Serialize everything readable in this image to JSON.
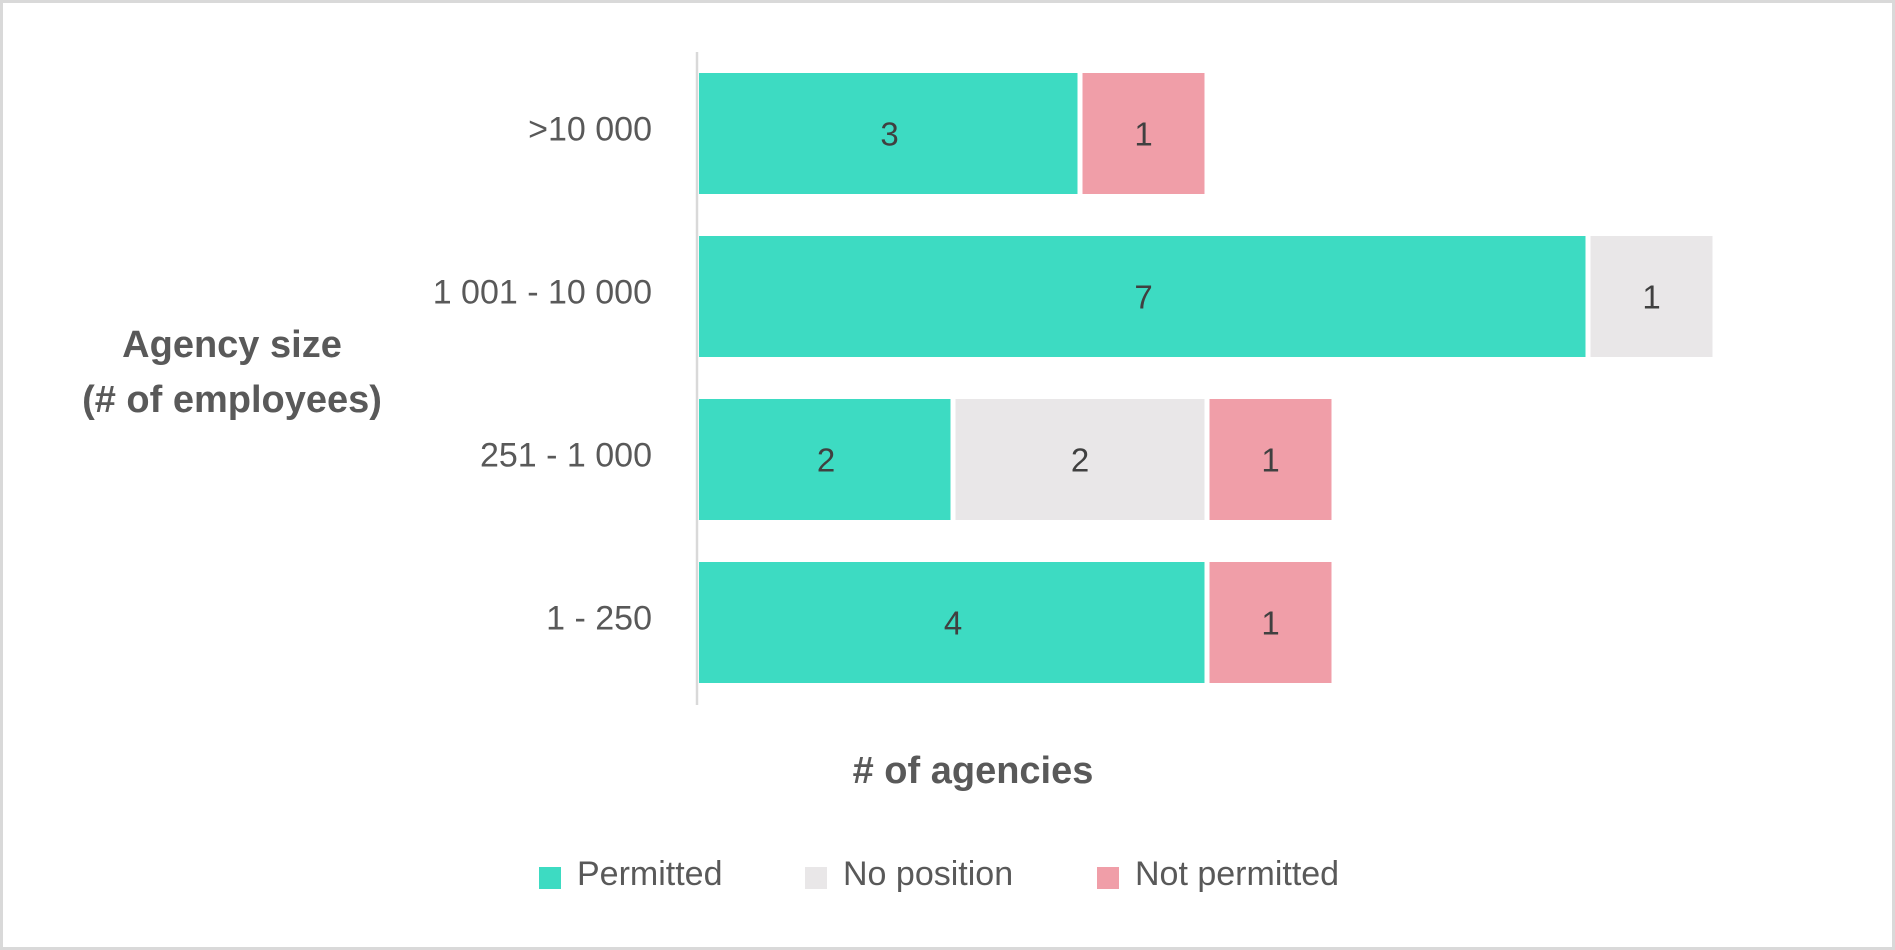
{
  "chart_data": {
    "type": "bar",
    "orientation": "horizontal",
    "stacked": true,
    "title": "",
    "xlabel": "# of agencies",
    "ylabel": [
      "Agency size",
      "(# of employees)"
    ],
    "categories": [
      ">10 000",
      "1 001 - 10 000",
      "251 - 1 000",
      "1 - 250"
    ],
    "series": [
      {
        "name": "Permitted",
        "color": "#3ddbc2",
        "values": [
          3,
          7,
          2,
          4
        ]
      },
      {
        "name": "No position",
        "color": "#e9e7e8",
        "values": [
          0,
          1,
          2,
          0
        ]
      },
      {
        "name": "Not permitted",
        "color": "#f09ea8",
        "values": [
          1,
          0,
          1,
          1
        ]
      }
    ],
    "xlim": [
      0,
      8
    ],
    "x_axis_visible": false,
    "grid": false,
    "data_labels": true,
    "legend_position": "bottom"
  }
}
